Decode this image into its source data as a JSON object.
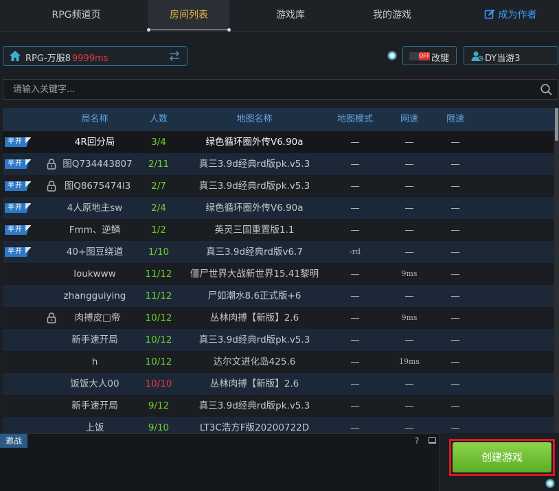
{
  "nav": {
    "tabs": [
      {
        "label": "RPG频道页"
      },
      {
        "label": "房间列表"
      },
      {
        "label": "游戏库"
      },
      {
        "label": "我的游戏"
      }
    ],
    "author_label": "成为作者"
  },
  "server": {
    "name": "RPG-万服8",
    "ping": "9999ms"
  },
  "key_toggle": {
    "state_label": "OFF",
    "label": "改键"
  },
  "user": {
    "name": "DY当游3"
  },
  "search": {
    "placeholder": "请输入关键字..."
  },
  "table": {
    "headers": {
      "room": "局名称",
      "players": "人数",
      "map": "地图名称",
      "mode": "地图模式",
      "ping": "网速",
      "limit": "限速"
    },
    "badge_label": "半开",
    "rows": [
      {
        "badge": true,
        "lock": false,
        "name": "4R回分局",
        "players": "3/4",
        "pcolor": "green",
        "map": "绿色循环圈外传V6.90a",
        "mode": "—",
        "ping": "—",
        "limit": "—"
      },
      {
        "badge": true,
        "lock": true,
        "name": "图Q734443807",
        "players": "2/11",
        "pcolor": "green",
        "map": "真三3.9d经典rd版pk.v5.3",
        "mode": "—",
        "ping": "—",
        "limit": "—"
      },
      {
        "badge": true,
        "lock": true,
        "name": "图Q8675474l3",
        "players": "2/7",
        "pcolor": "green",
        "map": "真三3.9d经典rd版pk.v5.3",
        "mode": "—",
        "ping": "—",
        "limit": "—"
      },
      {
        "badge": true,
        "lock": false,
        "name": "4人原地主sw",
        "players": "2/4",
        "pcolor": "green",
        "map": "绿色循环圈外传V6.90a",
        "mode": "—",
        "ping": "—",
        "limit": "—"
      },
      {
        "badge": true,
        "lock": false,
        "name": "Fmm、逆鳞",
        "players": "1/2",
        "pcolor": "green",
        "map": "英灵三国重置版1.1",
        "mode": "—",
        "ping": "—",
        "limit": "—"
      },
      {
        "badge": true,
        "lock": false,
        "name": "40+图豆绕道",
        "players": "1/10",
        "pcolor": "green",
        "map": "真三3.9d经典rd版v6.7",
        "mode": "-rd",
        "ping": "—",
        "limit": "—"
      },
      {
        "badge": false,
        "lock": false,
        "name": "loukwww",
        "players": "11/12",
        "pcolor": "green",
        "map": "僵尸世界大战新世界15.41黎明",
        "mode": "—",
        "ping": "9ms",
        "limit": "—"
      },
      {
        "badge": false,
        "lock": false,
        "name": "zhangguiying",
        "players": "11/12",
        "pcolor": "green",
        "map": "尸如潮水8.6正式版+6",
        "mode": "—",
        "ping": "—",
        "limit": "—"
      },
      {
        "badge": false,
        "lock": true,
        "name": "肉搏皮□帝",
        "players": "10/12",
        "pcolor": "green",
        "map": "丛林肉搏【新版】2.6",
        "mode": "—",
        "ping": "9ms",
        "limit": "—"
      },
      {
        "badge": false,
        "lock": false,
        "name": "新手速开局",
        "players": "10/12",
        "pcolor": "green",
        "map": "真三3.9d经典rd版pk.v5.3",
        "mode": "—",
        "ping": "—",
        "limit": "—"
      },
      {
        "badge": false,
        "lock": false,
        "name": "h",
        "players": "10/12",
        "pcolor": "green",
        "map": "达尔文进化岛425.6",
        "mode": "—",
        "ping": "19ms",
        "limit": "—"
      },
      {
        "badge": false,
        "lock": false,
        "name": "饭饭大人00",
        "players": "10/10",
        "pcolor": "red",
        "map": "丛林肉搏【新版】2.6",
        "mode": "—",
        "ping": "—",
        "limit": "—"
      },
      {
        "badge": false,
        "lock": false,
        "name": "新手速开局",
        "players": "9/12",
        "pcolor": "green",
        "map": "真三3.9d经典rd版pk.v5.3",
        "mode": "—",
        "ping": "—",
        "limit": "—"
      },
      {
        "badge": false,
        "lock": false,
        "name": "上饭",
        "players": "9/10",
        "pcolor": "green",
        "map": "LT3C浩方F版20200722D",
        "mode": "—",
        "ping": "—",
        "limit": "—"
      }
    ]
  },
  "bottom": {
    "challenge_tab": "邀战",
    "help": "?",
    "create_button": "创建游戏"
  },
  "colors": {
    "accent_gold": "#e8b54a",
    "link_blue": "#3f9bff",
    "ping_red": "#e53b3b",
    "players_green": "#6dd12c",
    "players_full_red": "#f0392f",
    "create_green": "#6cc033",
    "highlight_red": "#e1161e"
  }
}
